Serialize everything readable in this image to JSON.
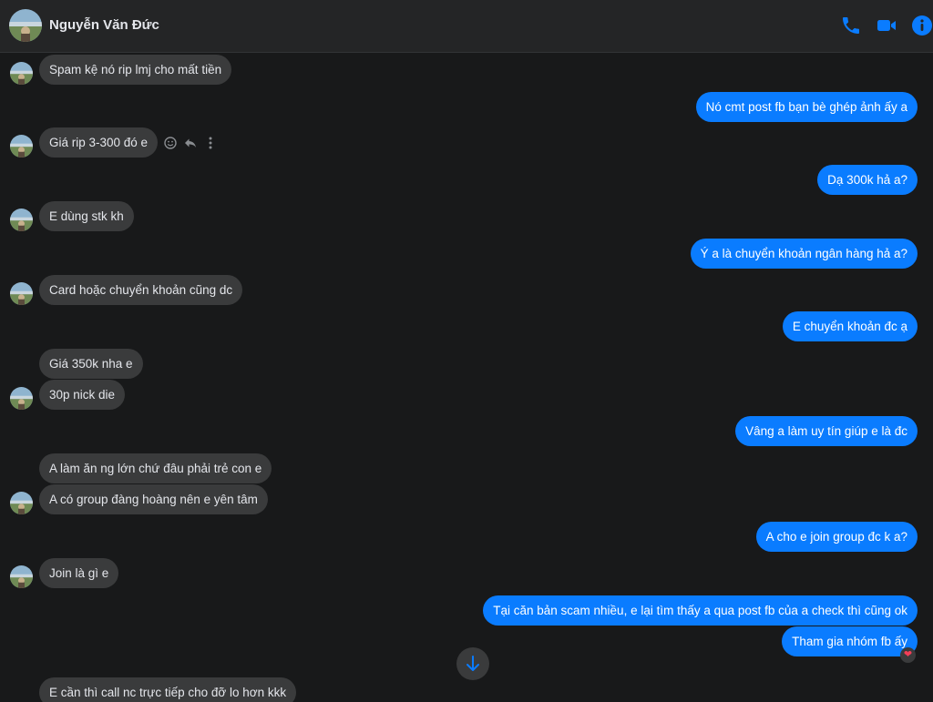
{
  "header": {
    "contact_name": "Nguyễn Văn Đức",
    "icons": [
      "phone-icon",
      "video-camera-icon",
      "info-icon"
    ],
    "accent_color": "#0a7cff"
  },
  "messages": [
    {
      "side": "incoming",
      "text": "Spam kệ nó rip lmj cho mất tiền"
    },
    {
      "side": "outgoing",
      "text": "Nó cmt post fb bạn bè ghép ảnh ấy a"
    },
    {
      "side": "incoming",
      "text": "Giá rip 3-300 đó e"
    },
    {
      "side": "outgoing",
      "text": "Dạ 300k hả a?"
    },
    {
      "side": "incoming",
      "text": "E dùng stk kh"
    },
    {
      "side": "outgoing",
      "text": "Ý a là chuyển khoản ngân hàng hả a?"
    },
    {
      "side": "incoming",
      "text": "Card hoặc chuyển khoản cũng dc"
    },
    {
      "side": "outgoing",
      "text": "E chuyển khoản đc ạ"
    },
    {
      "side": "incoming",
      "text": "Giá 350k nha e"
    },
    {
      "side": "incoming",
      "text": "30p nick die"
    },
    {
      "side": "outgoing",
      "text": "Vâng a làm uy tín giúp e là đc"
    },
    {
      "side": "incoming",
      "text": "A làm ăn ng lớn chứ đâu phải trẻ con e"
    },
    {
      "side": "incoming",
      "text": "A có group đàng hoàng nên e yên tâm"
    },
    {
      "side": "outgoing",
      "text": "A cho e join group đc k a?"
    },
    {
      "side": "incoming",
      "text": "Join là gì e"
    },
    {
      "side": "outgoing",
      "text": "Tại căn bản scam nhiều, e lại tìm thấy a qua post fb của a check thì cũng ok"
    },
    {
      "side": "outgoing",
      "text": "Tham gia nhóm fb ấy",
      "reaction": "❤"
    },
    {
      "side": "incoming",
      "text": "E cần thì call nc trực tiếp cho đỡ lo hơn kkk"
    }
  ],
  "message_actions": [
    "smile-icon",
    "reply-icon",
    "more-icon"
  ],
  "scroll_button_icon": "arrow-down-icon"
}
